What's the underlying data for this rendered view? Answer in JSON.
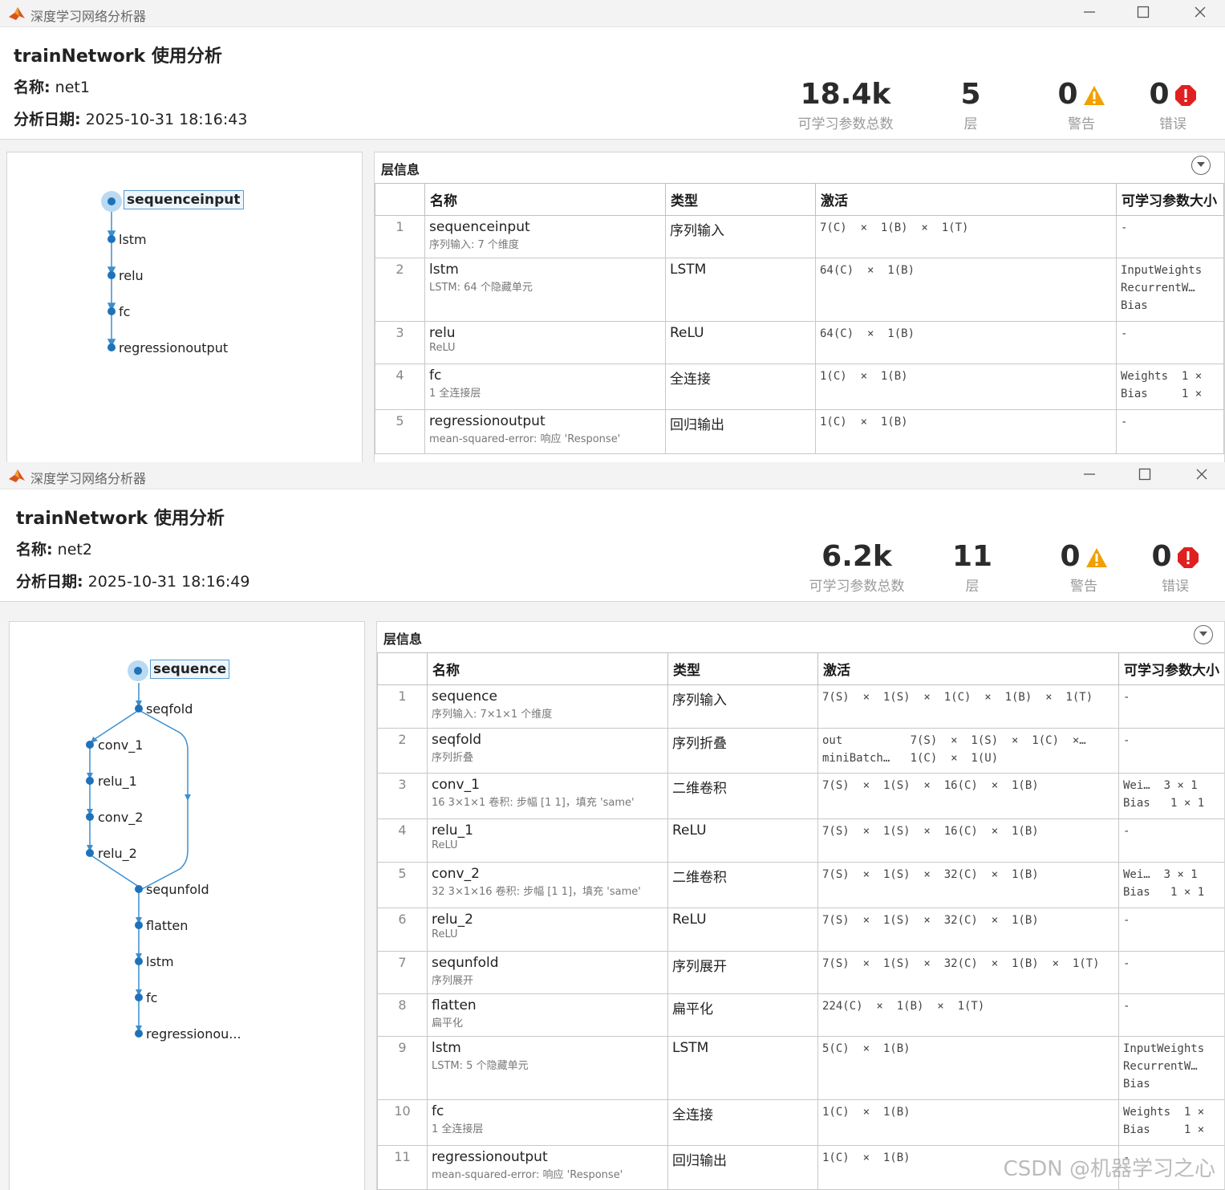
{
  "windows": [
    {
      "window_title": "深度学习网络分析器",
      "header": {
        "title": "trainNetwork 使用分析",
        "name_label": "名称:",
        "name_value": "net1",
        "date_label": "分析日期:",
        "date_value": "2025-10-31 18:16:43"
      },
      "stats": {
        "params": "18.4k",
        "params_label": "可学习参数总数",
        "layers": "5",
        "layers_label": "层",
        "warnings": "0",
        "warnings_label": "警告",
        "errors": "0",
        "errors_label": "错误"
      },
      "graph_nodes": [
        "sequenceinput",
        "lstm",
        "relu",
        "fc",
        "regressionoutput"
      ],
      "layer_panel_title": "层信息",
      "columns": [
        "名称",
        "类型",
        "激活",
        "可学习参数大小"
      ],
      "rows": [
        {
          "idx": "1",
          "name": "sequenceinput",
          "desc": "序列输入: 7 个维度",
          "type": "序列输入",
          "activation": "7(C)  ×  1(B)  ×  1(T)",
          "params": "-"
        },
        {
          "idx": "2",
          "name": "lstm",
          "desc": "LSTM: 64 个隐藏单元",
          "type": "LSTM",
          "activation": "64(C)  ×  1(B)",
          "params": "InputWeights\nRecurrentW…\nBias"
        },
        {
          "idx": "3",
          "name": "relu",
          "desc": "ReLU",
          "type": "ReLU",
          "activation": "64(C)  ×  1(B)",
          "params": "-"
        },
        {
          "idx": "4",
          "name": "fc",
          "desc": "1 全连接层",
          "type": "全连接",
          "activation": "1(C)  ×  1(B)",
          "params": "Weights  1 ×\nBias     1 ×"
        },
        {
          "idx": "5",
          "name": "regressionoutput",
          "desc": "mean-squared-error: 响应 'Response'",
          "type": "回归输出",
          "activation": "1(C)  ×  1(B)",
          "params": "-"
        }
      ]
    },
    {
      "window_title": "深度学习网络分析器",
      "header": {
        "title": "trainNetwork 使用分析",
        "name_label": "名称:",
        "name_value": "net2",
        "date_label": "分析日期:",
        "date_value": "2025-10-31 18:16:49"
      },
      "stats": {
        "params": "6.2k",
        "params_label": "可学习参数总数",
        "layers": "11",
        "layers_label": "层",
        "warnings": "0",
        "warnings_label": "警告",
        "errors": "0",
        "errors_label": "错误"
      },
      "graph_nodes": [
        "sequence",
        "seqfold",
        "conv_1",
        "relu_1",
        "conv_2",
        "relu_2",
        "sequnfold",
        "flatten",
        "lstm",
        "fc",
        "regressionou..."
      ],
      "layer_panel_title": "层信息",
      "columns": [
        "名称",
        "类型",
        "激活",
        "可学习参数大小"
      ],
      "rows": [
        {
          "idx": "1",
          "name": "sequence",
          "desc": "序列输入: 7×1×1 个维度",
          "type": "序列输入",
          "activation": "7(S)  ×  1(S)  ×  1(C)  ×  1(B)  ×  1(T)",
          "params": "-"
        },
        {
          "idx": "2",
          "name": "seqfold",
          "desc": "序列折叠",
          "type": "序列折叠",
          "activation": "out          7(S)  ×  1(S)  ×  1(C)  ×…\nminiBatch…   1(C)  ×  1(U)",
          "params": "-"
        },
        {
          "idx": "3",
          "name": "conv_1",
          "desc": "16 3×1×1 卷积: 步幅 [1 1]，填充 'same'",
          "type": "二维卷积",
          "activation": "7(S)  ×  1(S)  ×  16(C)  ×  1(B)",
          "params": "Wei…  3 × 1\nBias   1 × 1"
        },
        {
          "idx": "4",
          "name": "relu_1",
          "desc": "ReLU",
          "type": "ReLU",
          "activation": "7(S)  ×  1(S)  ×  16(C)  ×  1(B)",
          "params": "-"
        },
        {
          "idx": "5",
          "name": "conv_2",
          "desc": "32 3×1×16 卷积: 步幅 [1 1]，填充 'same'",
          "type": "二维卷积",
          "activation": "7(S)  ×  1(S)  ×  32(C)  ×  1(B)",
          "params": "Wei…  3 × 1\nBias   1 × 1"
        },
        {
          "idx": "6",
          "name": "relu_2",
          "desc": "ReLU",
          "type": "ReLU",
          "activation": "7(S)  ×  1(S)  ×  32(C)  ×  1(B)",
          "params": "-"
        },
        {
          "idx": "7",
          "name": "sequnfold",
          "desc": "序列展开",
          "type": "序列展开",
          "activation": "7(S)  ×  1(S)  ×  32(C)  ×  1(B)  ×  1(T)",
          "params": "-"
        },
        {
          "idx": "8",
          "name": "flatten",
          "desc": "扁平化",
          "type": "扁平化",
          "activation": "224(C)  ×  1(B)  ×  1(T)",
          "params": "-"
        },
        {
          "idx": "9",
          "name": "lstm",
          "desc": "LSTM: 5 个隐藏单元",
          "type": "LSTM",
          "activation": "5(C)  ×  1(B)",
          "params": "InputWeights\nRecurrentW…\nBias"
        },
        {
          "idx": "10",
          "name": "fc",
          "desc": "1 全连接层",
          "type": "全连接",
          "activation": "1(C)  ×  1(B)",
          "params": "Weights  1 ×\nBias     1 ×"
        },
        {
          "idx": "11",
          "name": "regressionoutput",
          "desc": "mean-squared-error: 响应 'Response'",
          "type": "回归输出",
          "activation": "1(C)  ×  1(B)",
          "params": "-"
        }
      ]
    }
  ],
  "watermark": "CSDN @机器学习之心",
  "colors": {
    "accent": "#1f72b8",
    "warning": "#f0a000",
    "error": "#e02020"
  },
  "icons": [
    "matlab-icon",
    "minimize-icon",
    "maximize-icon",
    "close-icon",
    "warning-icon",
    "error-icon",
    "collapse-icon"
  ]
}
